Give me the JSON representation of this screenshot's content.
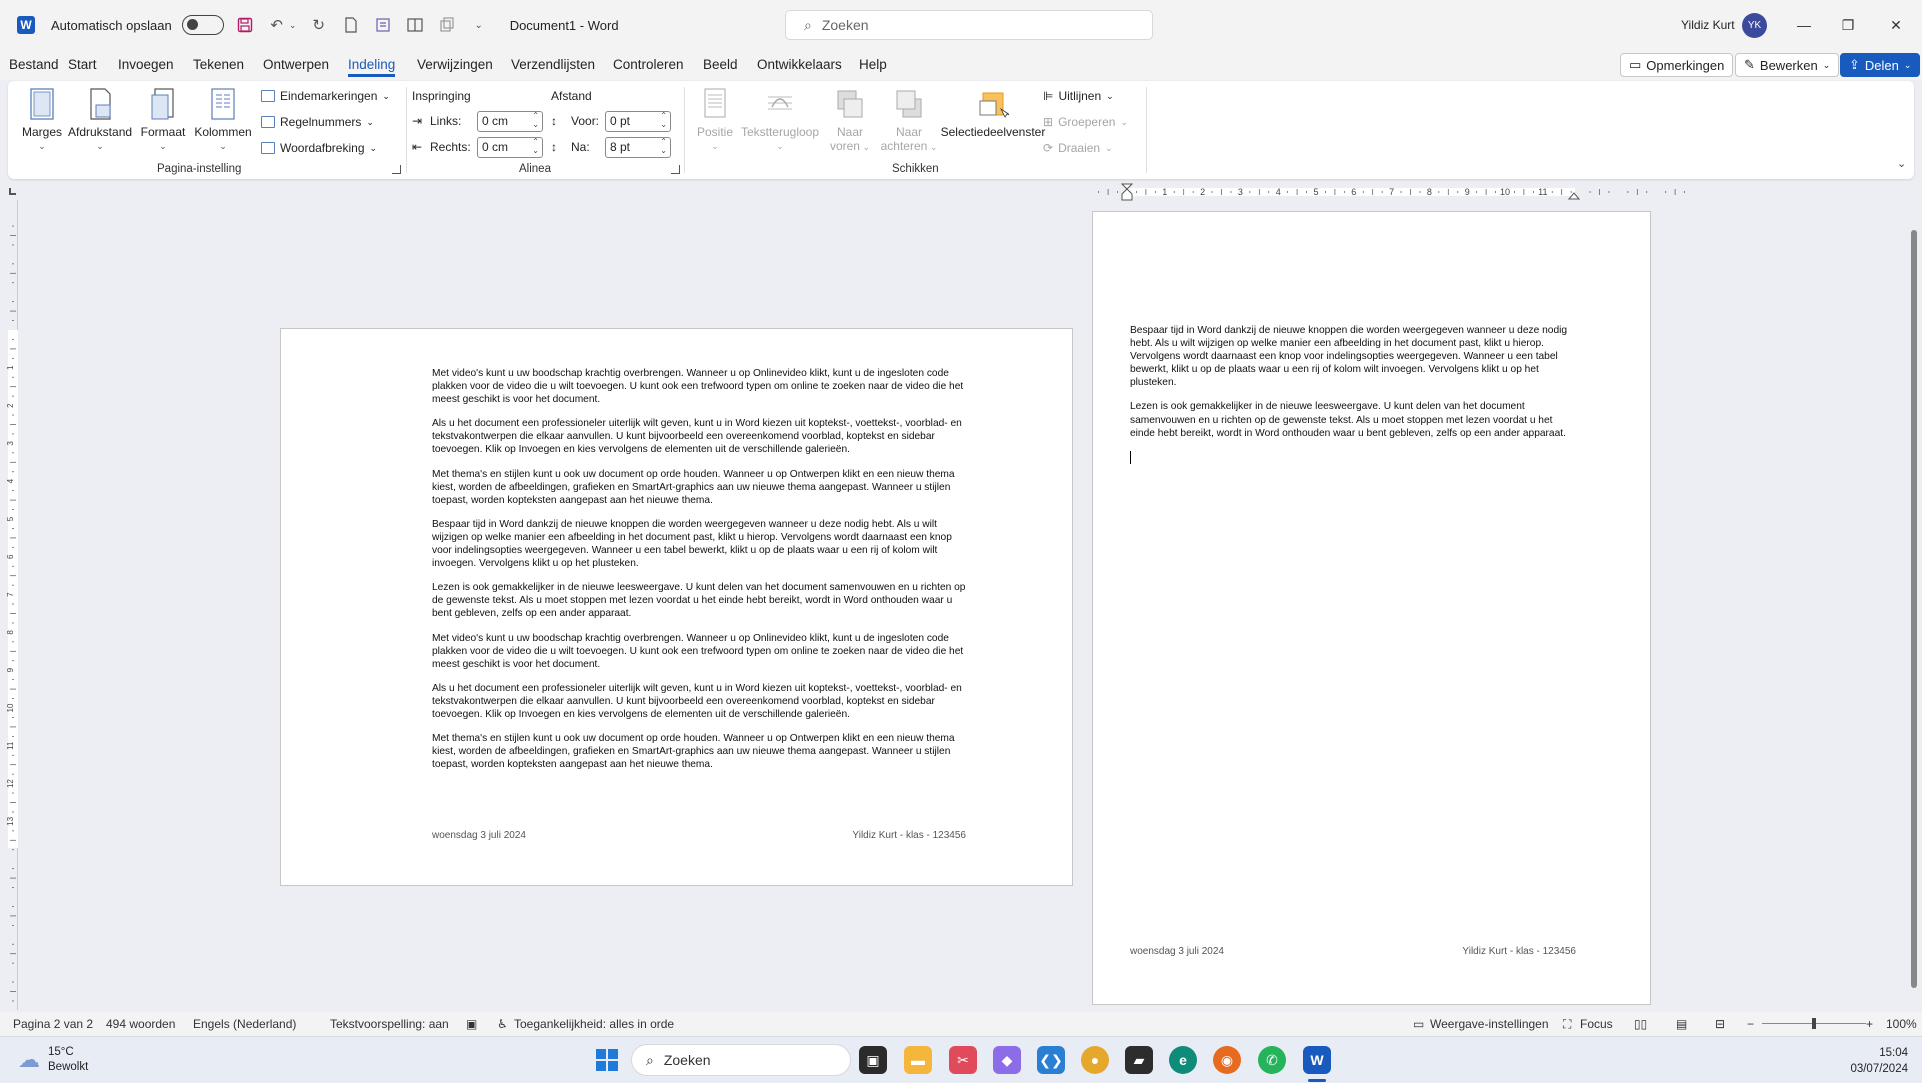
{
  "titlebar": {
    "autosave_label": "Automatisch opslaan",
    "doc_title": "Document1  -  Word",
    "search_placeholder": "Zoeken",
    "user_name": "Yildiz Kurt",
    "user_initials": "YK"
  },
  "menu": {
    "tabs": [
      "Bestand",
      "Start",
      "Invoegen",
      "Tekenen",
      "Ontwerpen",
      "Indeling",
      "Verwijzingen",
      "Verzendlijsten",
      "Controleren",
      "Beeld",
      "Ontwikkelaars",
      "Help"
    ],
    "active_tab": "Indeling",
    "comments_label": "Opmerkingen",
    "edit_label": "Bewerken",
    "share_label": "Delen"
  },
  "ribbon": {
    "page_setup": {
      "group_label": "Pagina-instelling",
      "margins": "Marges",
      "orientation": "Afdrukstand",
      "size": "Formaat",
      "columns": "Kolommen",
      "breaks": "Eindemarkeringen",
      "line_numbers": "Regelnummers",
      "hyphenation": "Woordafbreking"
    },
    "paragraph": {
      "group_label": "Alinea",
      "indent_label": "Inspringing",
      "spacing_label": "Afstand",
      "left_label": "Links:",
      "left_value": "0 cm",
      "right_label": "Rechts:",
      "right_value": "0 cm",
      "before_label": "Voor:",
      "before_value": "0 pt",
      "after_label": "Na:",
      "after_value": "8 pt"
    },
    "arrange": {
      "group_label": "Schikken",
      "position": "Positie",
      "wrap_text": "Tekstterugloop",
      "bring_forward_1": "Naar",
      "bring_forward_2": "voren",
      "send_backward_1": "Naar",
      "send_backward_2": "achteren",
      "selection_pane": "Selectiedeelvenster",
      "align": "Uitlijnen",
      "group": "Groeperen",
      "rotate": "Draaien"
    }
  },
  "ruler": {
    "h_ticks": [
      "1",
      "2",
      "3",
      "4",
      "5",
      "6",
      "7",
      "8",
      "9",
      "10",
      "11"
    ],
    "v_ticks": [
      "1",
      "2",
      "3",
      "4",
      "5",
      "6",
      "7",
      "8",
      "9",
      "10",
      "11",
      "12",
      "13"
    ]
  },
  "page1": {
    "paragraphs": [
      "Met video's kunt u uw boodschap krachtig overbrengen. Wanneer u op Onlinevideo klikt, kunt u de ingesloten code plakken voor de video die u wilt toevoegen. U kunt ook een trefwoord typen om online te zoeken naar de video die het meest geschikt is voor het document.",
      "Als u het document een professioneler uiterlijk wilt geven, kunt u in Word kiezen uit koptekst-, voettekst-, voorblad- en tekstvakontwerpen die elkaar aanvullen. U kunt bijvoorbeeld een overeenkomend voorblad, koptekst en sidebar toevoegen. Klik op Invoegen en kies vervolgens de elementen uit de verschillende galerieën.",
      "Met thema's en stijlen kunt u ook uw document op orde houden. Wanneer u op Ontwerpen klikt en een nieuw thema kiest, worden de afbeeldingen, grafieken en SmartArt-graphics aan uw nieuwe thema aangepast. Wanneer u stijlen toepast, worden kopteksten aangepast aan het nieuwe thema.",
      "Bespaar tijd in Word dankzij de nieuwe knoppen die worden weergegeven wanneer u deze nodig hebt. Als u wilt wijzigen op welke manier een afbeelding in het document past, klikt u hierop. Vervolgens wordt daarnaast een knop voor indelingsopties weergegeven. Wanneer u een tabel bewerkt, klikt u op de plaats waar u een rij of kolom wilt invoegen. Vervolgens klikt u op het plusteken.",
      "Lezen is ook gemakkelijker in de nieuwe leesweergave. U kunt delen van het document samenvouwen en u richten op de gewenste tekst. Als u moet stoppen met lezen voordat u het einde hebt bereikt, wordt in Word onthouden waar u bent gebleven, zelfs op een ander apparaat.",
      "Met video's kunt u uw boodschap krachtig overbrengen. Wanneer u op Onlinevideo klikt, kunt u de ingesloten code plakken voor de video die u wilt toevoegen. U kunt ook een trefwoord typen om online te zoeken naar de video die het meest geschikt is voor het document.",
      "Als u het document een professioneler uiterlijk wilt geven, kunt u in Word kiezen uit koptekst-, voettekst-, voorblad- en tekstvakontwerpen die elkaar aanvullen. U kunt bijvoorbeeld een overeenkomend voorblad, koptekst en sidebar toevoegen. Klik op Invoegen en kies vervolgens de elementen uit de verschillende galerieën.",
      "Met thema's en stijlen kunt u ook uw document op orde houden. Wanneer u op Ontwerpen klikt en een nieuw thema kiest, worden de afbeeldingen, grafieken en SmartArt-graphics aan uw nieuwe thema aangepast. Wanneer u stijlen toepast, worden kopteksten aangepast aan het nieuwe thema."
    ],
    "footer_left": "woensdag 3 juli 2024",
    "footer_right": "Yildiz Kurt - klas - 123456"
  },
  "page2": {
    "paragraphs": [
      "Bespaar tijd in Word dankzij de nieuwe knoppen die worden weergegeven wanneer u deze nodig hebt. Als u wilt wijzigen op welke manier een afbeelding in het document past, klikt u hierop. Vervolgens wordt daarnaast een knop voor indelingsopties weergegeven. Wanneer u een tabel bewerkt, klikt u op de plaats waar u een rij of kolom wilt invoegen. Vervolgens klikt u op het plusteken.",
      "Lezen is ook gemakkelijker in de nieuwe leesweergave. U kunt delen van het document samenvouwen en u richten op de gewenste tekst. Als u moet stoppen met lezen voordat u het einde hebt bereikt, wordt in Word onthouden waar u bent gebleven, zelfs op een ander apparaat."
    ],
    "footer_left": "woensdag 3 juli 2024",
    "footer_right": "Yildiz Kurt - klas - 123456"
  },
  "status": {
    "page": "Pagina 2 van 2",
    "words": "494 woorden",
    "language": "Engels (Nederland)",
    "text_predictions": "Tekstvoorspelling: aan",
    "accessibility": "Toegankelijkheid: alles in orde",
    "display_settings": "Weergave-instellingen",
    "focus": "Focus",
    "zoom": "100%"
  },
  "taskbar": {
    "temperature": "15°C",
    "weather": "Bewolkt",
    "search_label": "Zoeken",
    "time": "15:04",
    "date": "03/07/2024"
  }
}
